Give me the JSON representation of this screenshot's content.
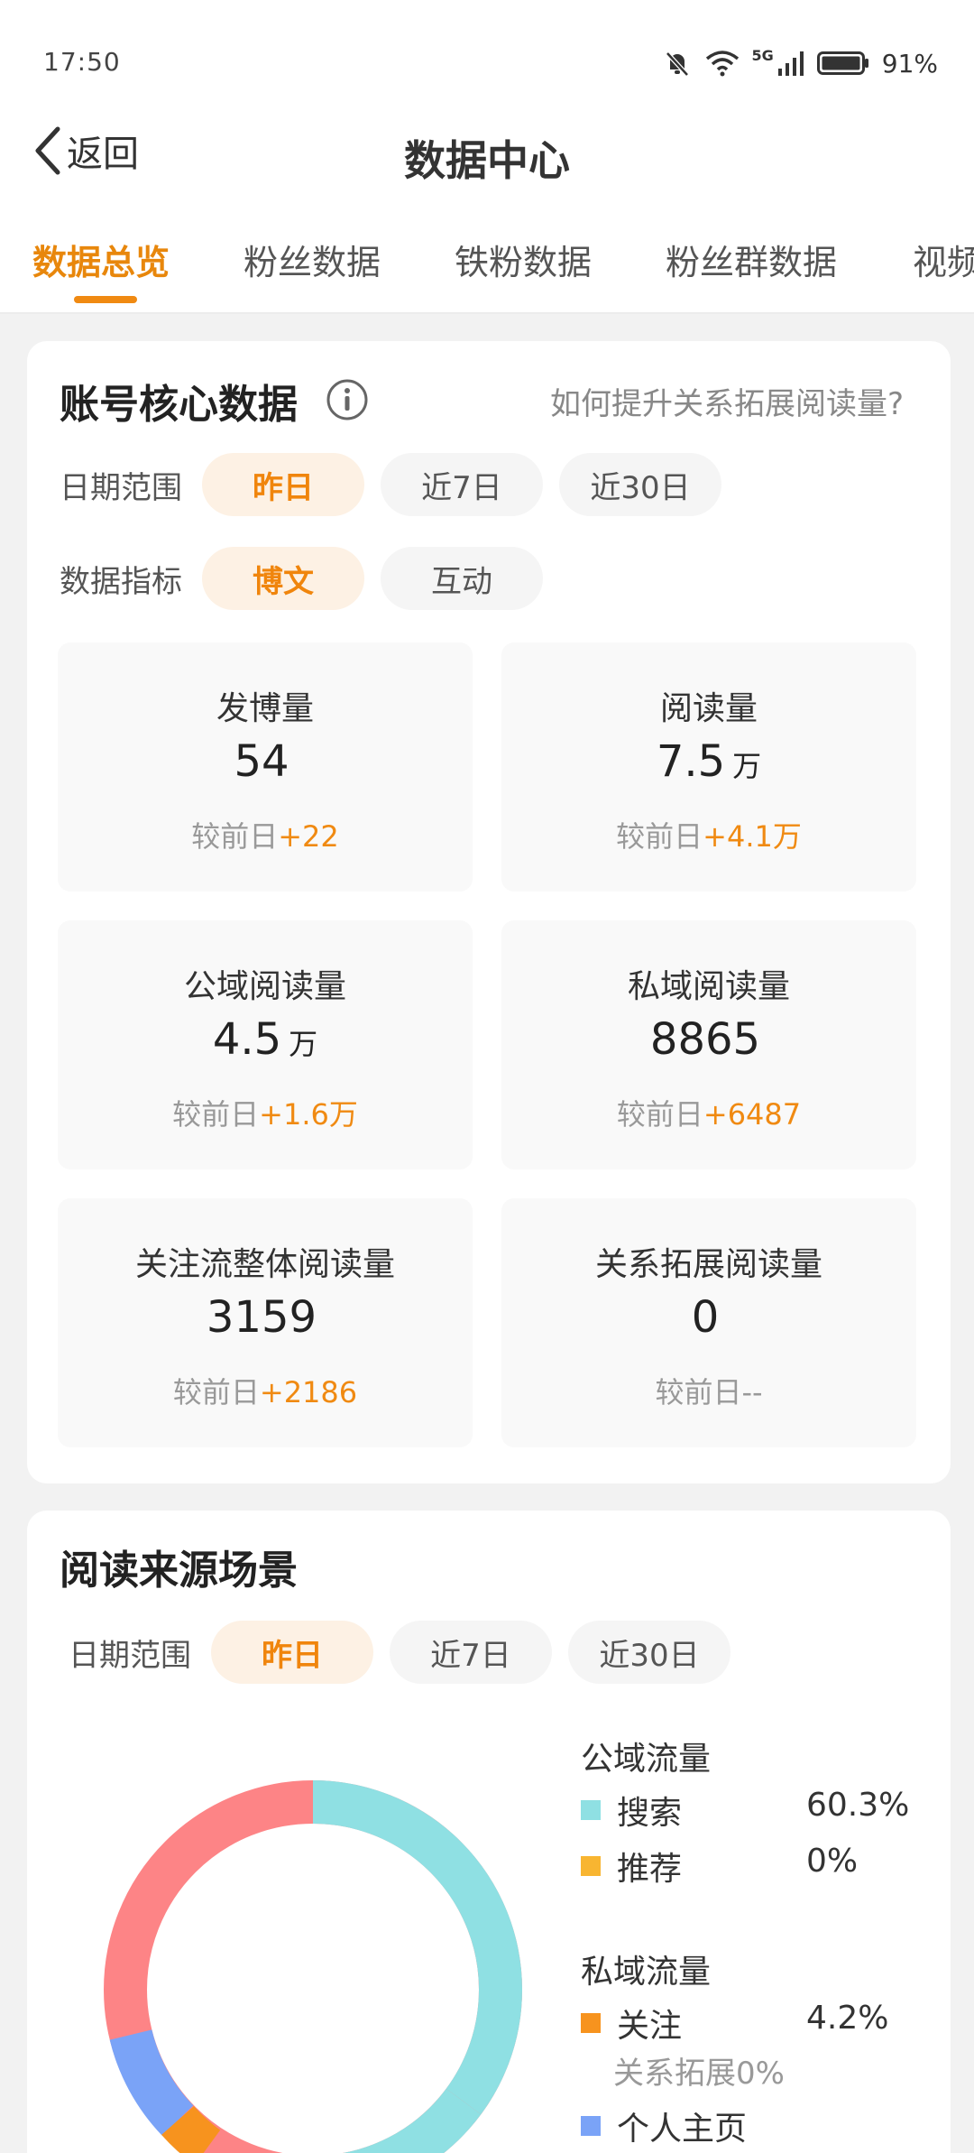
{
  "status_bar": {
    "time": "17:50",
    "network": "5G",
    "battery": "91%"
  },
  "nav": {
    "back_label": "返回",
    "title": "数据中心"
  },
  "tabs": [
    {
      "label": "数据总览",
      "active": true
    },
    {
      "label": "粉丝数据",
      "active": false
    },
    {
      "label": "铁粉数据",
      "active": false
    },
    {
      "label": "粉丝群数据",
      "active": false
    },
    {
      "label": "视频",
      "active": false
    }
  ],
  "core": {
    "title": "账号核心数据",
    "help_link": "如何提升关系拓展阅读量?",
    "date_label": "日期范围",
    "date_options": [
      "昨日",
      "近7日",
      "近30日"
    ],
    "metric_label": "数据指标",
    "metric_options": [
      "博文",
      "互动"
    ],
    "stats": [
      {
        "label": "发博量",
        "value": "54",
        "unit": "",
        "compare": "较前日",
        "delta": "+22"
      },
      {
        "label": "阅读量",
        "value": "7.5",
        "unit": "万",
        "compare": "较前日",
        "delta": "+4.1万"
      },
      {
        "label": "公域阅读量",
        "value": "4.5",
        "unit": "万",
        "compare": "较前日",
        "delta": "+1.6万"
      },
      {
        "label": "私域阅读量",
        "value": "8865",
        "unit": "",
        "compare": "较前日",
        "delta": "+6487"
      },
      {
        "label": "关注流整体阅读量",
        "value": "3159",
        "unit": "",
        "compare": "较前日",
        "delta": "+2186"
      },
      {
        "label": "关系拓展阅读量",
        "value": "0",
        "unit": "",
        "compare": "较前日",
        "delta": "--"
      }
    ]
  },
  "source": {
    "title": "阅读来源场景",
    "date_label": "日期范围",
    "date_options": [
      "昨日",
      "近7日",
      "近30日"
    ],
    "public_title": "公域流量",
    "private_title": "私域流量",
    "public_items": [
      {
        "label": "搜索",
        "pct": "60.3%",
        "color": "#8fe0e3"
      },
      {
        "label": "推荐",
        "pct": "0%",
        "color": "#f8b531"
      }
    ],
    "private_items": [
      {
        "label": "关注",
        "pct": "4.2%",
        "color": "#f7931e"
      },
      {
        "label": "个人主页",
        "pct": "",
        "color": "#7aa3f7"
      }
    ],
    "relation_sub": "关系拓展0%",
    "donut_colors": {
      "search": "#8fe0e3",
      "red": "#fd8486",
      "blue": "#7aa3f7",
      "orange": "#f7931e"
    }
  }
}
